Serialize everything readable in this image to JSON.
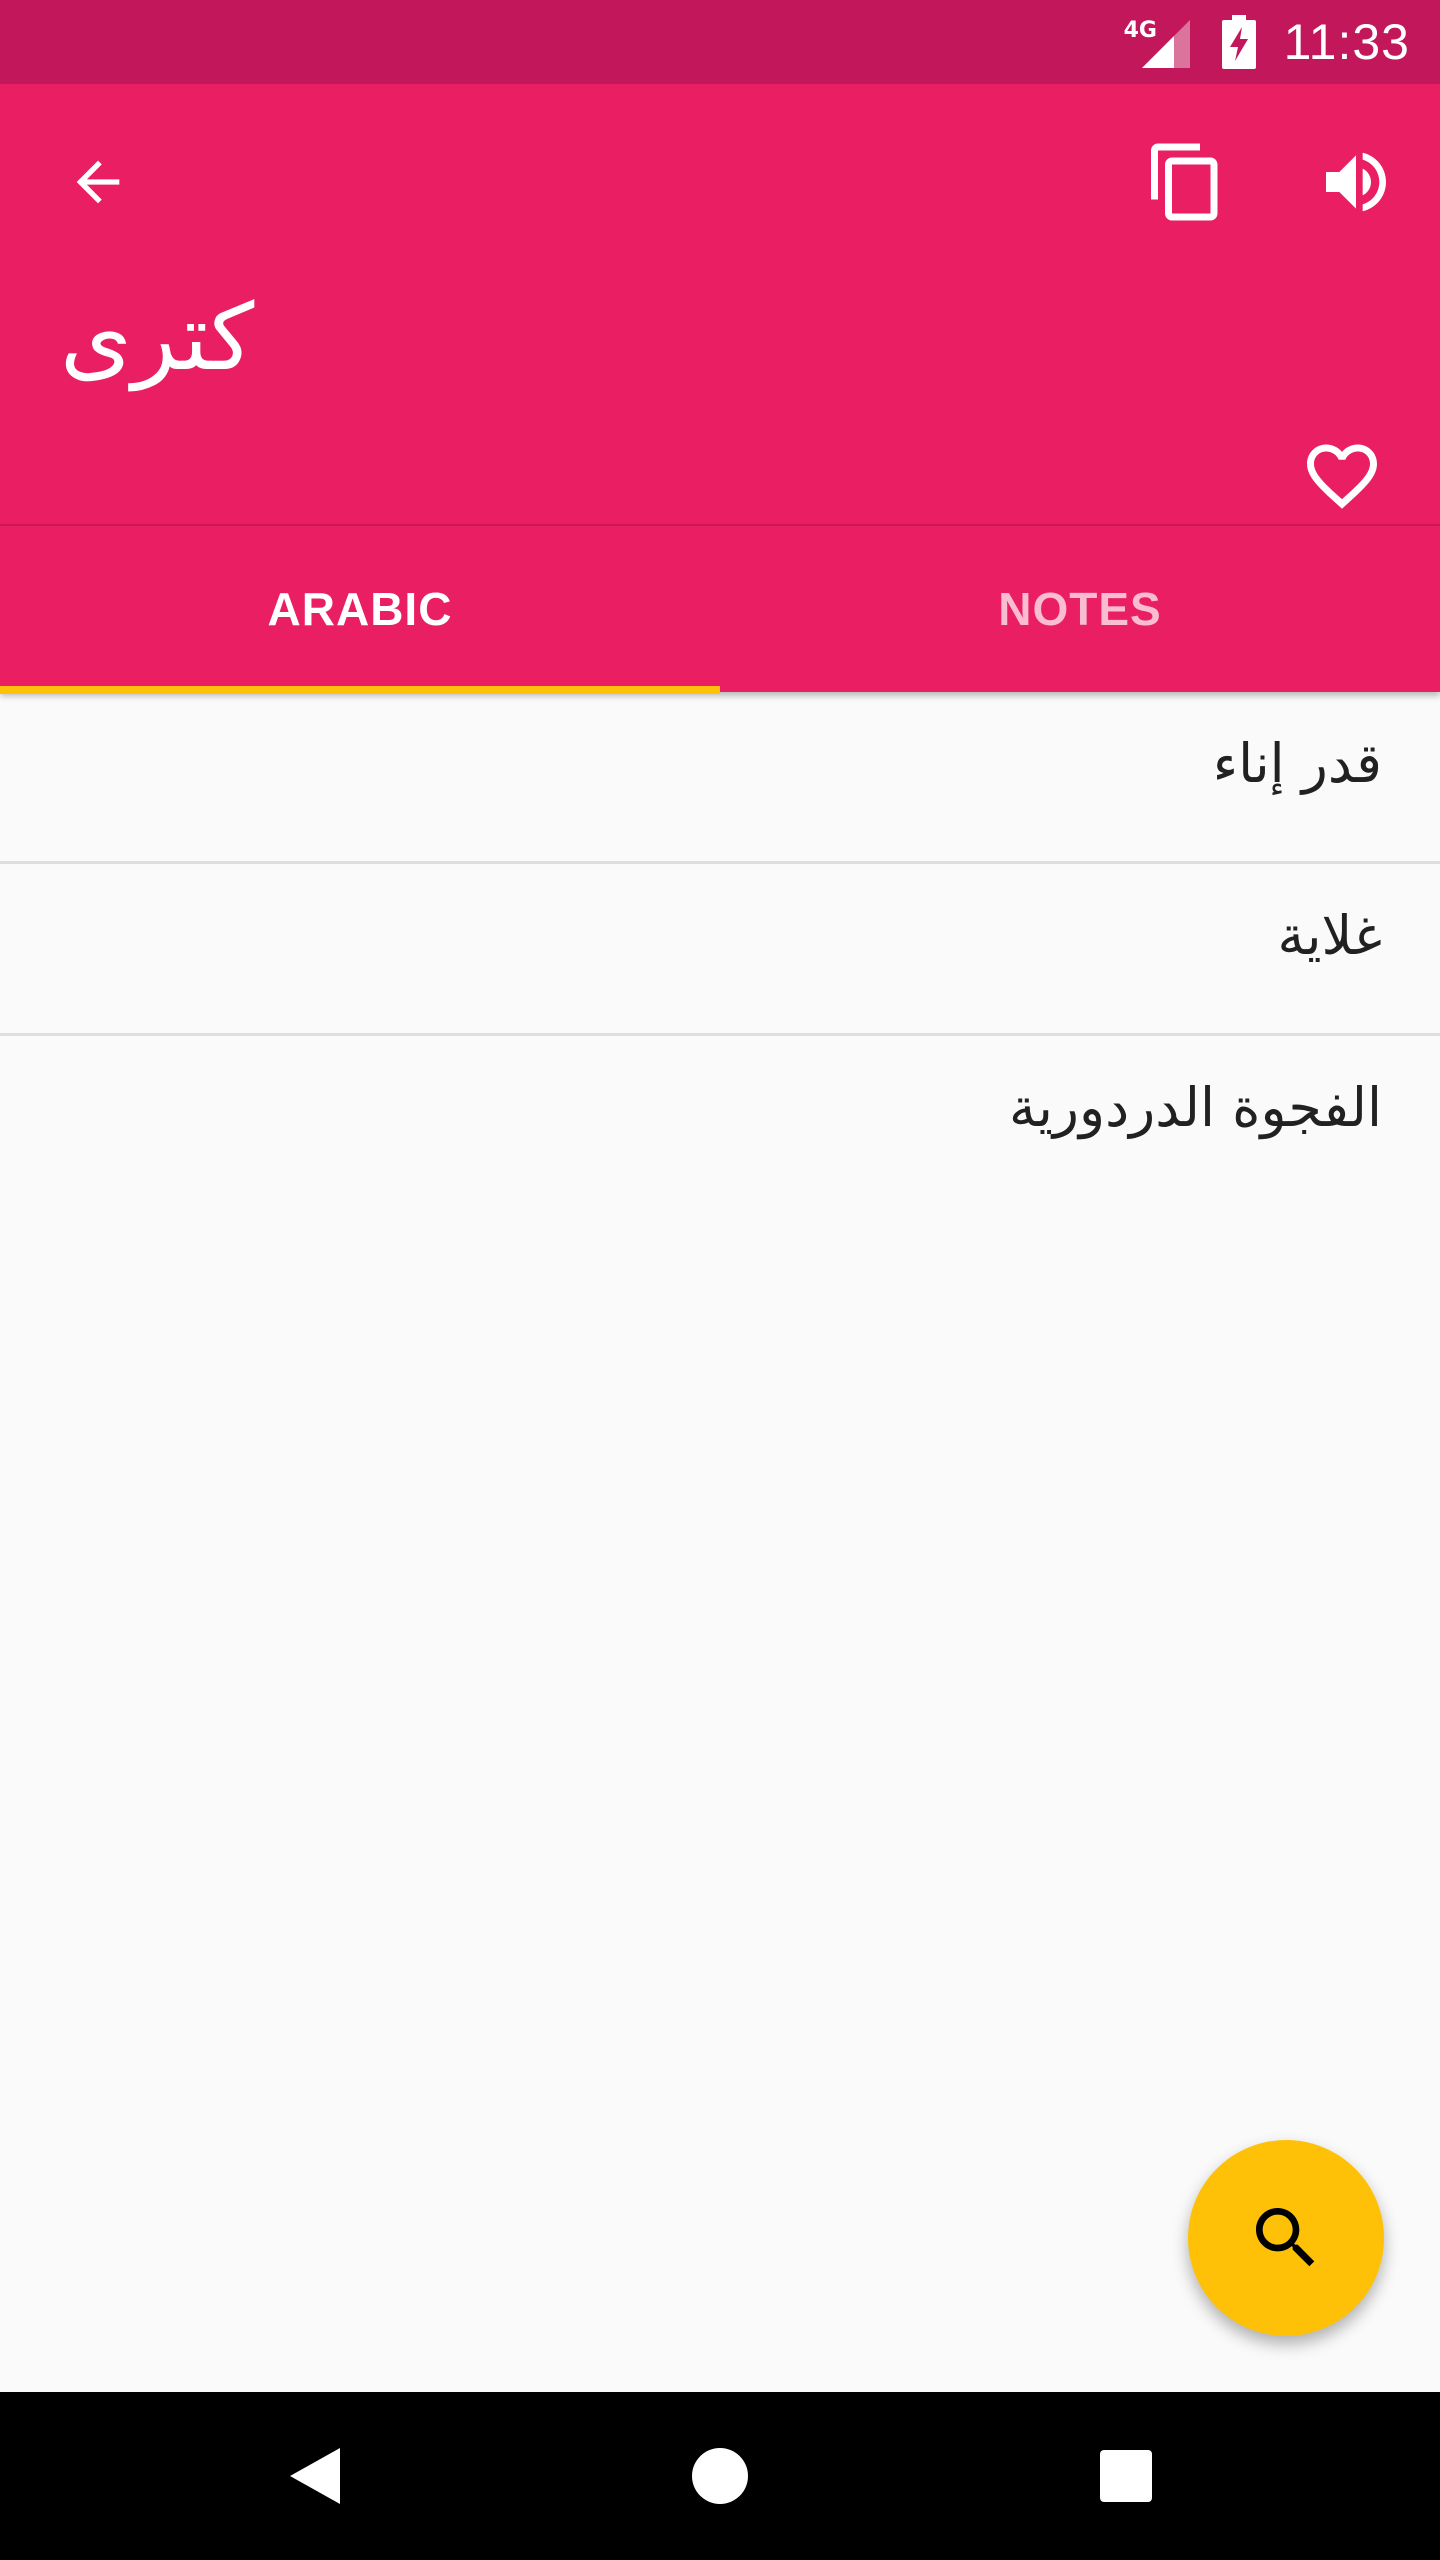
{
  "status_bar": {
    "network_label": "4G",
    "time": "11:33",
    "icons": [
      "signal-icon",
      "battery-charging-icon"
    ]
  },
  "app_bar": {
    "title": "كترى",
    "icons": [
      "back-arrow-icon",
      "copy-icon",
      "volume-icon",
      "heart-outline-icon"
    ]
  },
  "tabs": [
    {
      "label": "ARABIC",
      "selected": true
    },
    {
      "label": "NOTES",
      "selected": false
    }
  ],
  "list": {
    "items": [
      {
        "text": "قدر إناء"
      },
      {
        "text": "غلاية"
      },
      {
        "text": "الفجوة الدردورية"
      }
    ]
  },
  "fab": {
    "icon": "search-icon"
  },
  "nav_bar": {
    "icons": [
      "back-triangle-icon",
      "home-circle-icon",
      "recents-square-icon"
    ]
  },
  "colors": {
    "status_bar": "#c2185b",
    "primary": "#e91e63",
    "accent": "#ffc107",
    "background": "#fafafa"
  }
}
